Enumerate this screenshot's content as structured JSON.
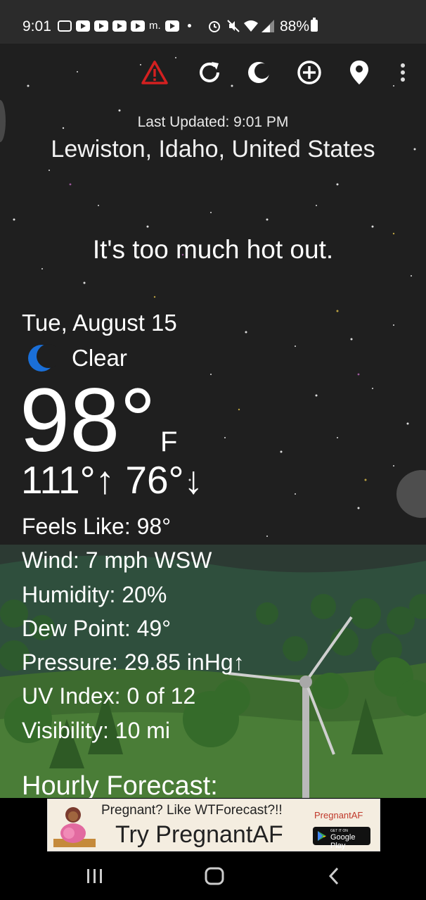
{
  "status_bar": {
    "time": "9:01",
    "notif_extra": "m.",
    "battery": "88%"
  },
  "toolbar": {
    "icons": [
      "alert-icon",
      "refresh-icon",
      "theme-icon",
      "add-location-icon",
      "location-pin-icon",
      "more-icon"
    ],
    "alert_color": "#d32020"
  },
  "weather": {
    "last_updated": "Last Updated: 9:01 PM",
    "location": "Lewiston, Idaho, United States",
    "tagline": "It's too much hot out.",
    "date": "Tue, August 15",
    "condition": "Clear",
    "condition_icon": "moon-icon",
    "temperature": "98°",
    "unit": "F",
    "high_low": "111°↑ 76°↓",
    "details": {
      "feels_like": "Feels Like:  98°",
      "wind": "Wind:  7 mph WSW",
      "humidity": "Humidity:  20%",
      "dew_point": "Dew Point:  49°",
      "pressure": "Pressure:  29.85 inHg↑",
      "uv_index": "UV Index:  0 of 12",
      "visibility": "Visibility:  10 mi"
    },
    "hourly_heading": "Hourly Forecast:"
  },
  "ad": {
    "line1": "Pregnant? Like WTForecast?!!",
    "brand": "PregnantAF",
    "line2": "Try PregnantAF",
    "store_small": "GET IT ON",
    "store_big": "Google Play"
  },
  "colors": {
    "sky": "#1f1f1f",
    "hill": "#3d6b2f",
    "moon": "#1a6fd8"
  }
}
